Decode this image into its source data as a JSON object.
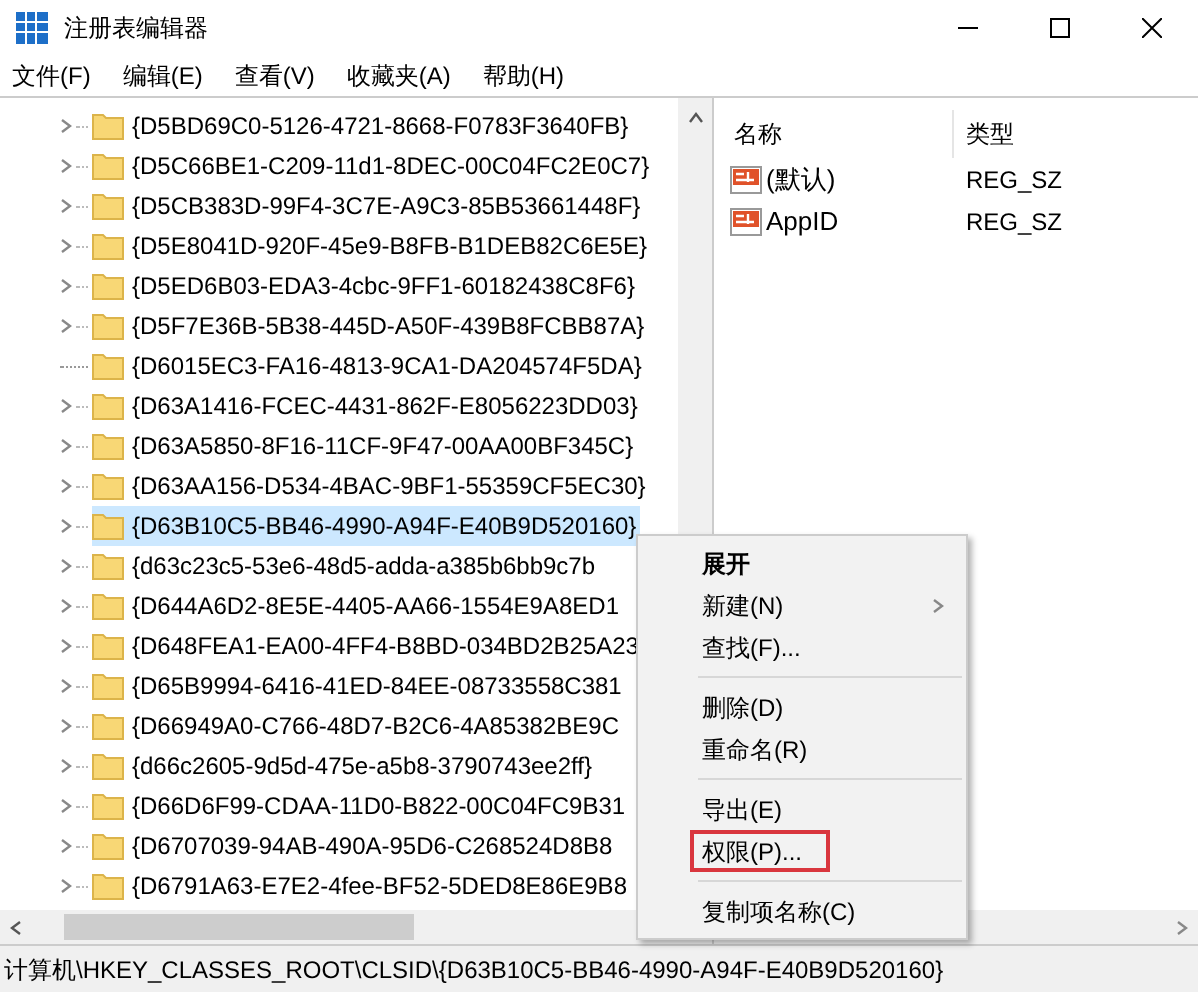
{
  "window": {
    "title": "注册表编辑器"
  },
  "menu_bar": [
    "文件(F)",
    "编辑(E)",
    "查看(V)",
    "收藏夹(A)",
    "帮助(H)"
  ],
  "tree": {
    "items": [
      {
        "label": "{D5BD69C0-5126-4721-8668-F0783F3640FB}",
        "expandable": true,
        "selected": false
      },
      {
        "label": "{D5C66BE1-C209-11d1-8DEC-00C04FC2E0C7}",
        "expandable": true,
        "selected": false
      },
      {
        "label": "{D5CB383D-99F4-3C7E-A9C3-85B53661448F}",
        "expandable": true,
        "selected": false
      },
      {
        "label": "{D5E8041D-920F-45e9-B8FB-B1DEB82C6E5E}",
        "expandable": true,
        "selected": false
      },
      {
        "label": "{D5ED6B03-EDA3-4cbc-9FF1-60182438C8F6}",
        "expandable": true,
        "selected": false
      },
      {
        "label": "{D5F7E36B-5B38-445D-A50F-439B8FCBB87A}",
        "expandable": true,
        "selected": false
      },
      {
        "label": "{D6015EC3-FA16-4813-9CA1-DA204574F5DA}",
        "expandable": false,
        "selected": false
      },
      {
        "label": "{D63A1416-FCEC-4431-862F-E8056223DD03}",
        "expandable": true,
        "selected": false
      },
      {
        "label": "{D63A5850-8F16-11CF-9F47-00AA00BF345C}",
        "expandable": true,
        "selected": false
      },
      {
        "label": "{D63AA156-D534-4BAC-9BF1-55359CF5EC30}",
        "expandable": true,
        "selected": false
      },
      {
        "label": "{D63B10C5-BB46-4990-A94F-E40B9D520160}",
        "expandable": true,
        "selected": true
      },
      {
        "label": "{d63c23c5-53e6-48d5-adda-a385b6bb9c7b",
        "expandable": true,
        "selected": false
      },
      {
        "label": "{D644A6D2-8E5E-4405-AA66-1554E9A8ED1",
        "expandable": true,
        "selected": false
      },
      {
        "label": "{D648FEA1-EA00-4FF4-B8BD-034BD2B25A23",
        "expandable": true,
        "selected": false
      },
      {
        "label": "{D65B9994-6416-41ED-84EE-08733558C381",
        "expandable": true,
        "selected": false
      },
      {
        "label": "{D66949A0-C766-48D7-B2C6-4A85382BE9C",
        "expandable": true,
        "selected": false
      },
      {
        "label": "{d66c2605-9d5d-475e-a5b8-3790743ee2ff}",
        "expandable": true,
        "selected": false
      },
      {
        "label": "{D66D6F99-CDAA-11D0-B822-00C04FC9B31",
        "expandable": true,
        "selected": false
      },
      {
        "label": "{D6707039-94AB-490A-95D6-C268524D8B8",
        "expandable": true,
        "selected": false
      },
      {
        "label": "{D6791A63-E7E2-4fee-BF52-5DED8E86E9B8",
        "expandable": true,
        "selected": false
      }
    ]
  },
  "values": {
    "columns": [
      "名称",
      "类型"
    ],
    "rows": [
      {
        "name": "(默认)",
        "type": "REG_SZ"
      },
      {
        "name": "AppID",
        "type": "REG_SZ"
      }
    ]
  },
  "context_menu": {
    "items": [
      {
        "kind": "item",
        "label": "展开",
        "bold": true,
        "submenu": false,
        "annotated": false
      },
      {
        "kind": "item",
        "label": "新建(N)",
        "bold": false,
        "submenu": true,
        "annotated": false
      },
      {
        "kind": "item",
        "label": "查找(F)...",
        "bold": false,
        "submenu": false,
        "annotated": false
      },
      {
        "kind": "separator"
      },
      {
        "kind": "item",
        "label": "删除(D)",
        "bold": false,
        "submenu": false,
        "annotated": false
      },
      {
        "kind": "item",
        "label": "重命名(R)",
        "bold": false,
        "submenu": false,
        "annotated": false
      },
      {
        "kind": "separator"
      },
      {
        "kind": "item",
        "label": "导出(E)",
        "bold": false,
        "submenu": false,
        "annotated": false
      },
      {
        "kind": "item",
        "label": "权限(P)...",
        "bold": false,
        "submenu": false,
        "annotated": true
      },
      {
        "kind": "separator"
      },
      {
        "kind": "item",
        "label": "复制项名称(C)",
        "bold": false,
        "submenu": false,
        "annotated": false
      }
    ]
  },
  "status_bar": "计算机\\HKEY_CLASSES_ROOT\\CLSID\\{D63B10C5-BB46-4990-A94F-E40B9D520160}"
}
